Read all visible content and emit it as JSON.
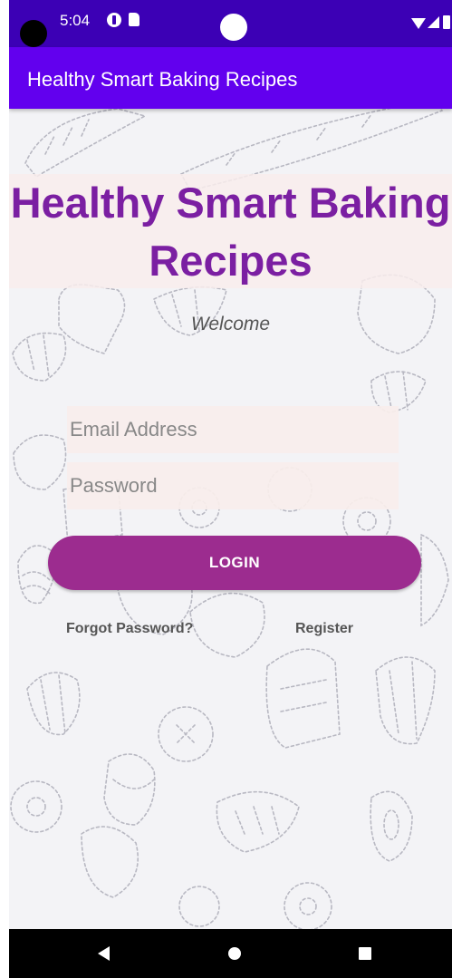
{
  "status_bar": {
    "time": "5:04"
  },
  "app_bar": {
    "title": "Healthy Smart Baking Recipes"
  },
  "main": {
    "heading": "Healthy Smart Baking Recipes",
    "welcome": "Welcome",
    "email_placeholder": "Email Address",
    "password_placeholder": "Password",
    "login_label": "LOGIN",
    "forgot_password": "Forgot Password?",
    "register": "Register"
  },
  "colors": {
    "status_bar": "#3c00b5",
    "app_bar": "#6200ee",
    "heading": "#7b1fa2",
    "login_button": "#9c2c8f"
  },
  "icons": [
    "camera-icon",
    "notification-icon",
    "sd-card-icon",
    "wifi-icon",
    "signal-icon",
    "battery-icon",
    "back-icon",
    "home-icon",
    "recents-icon"
  ]
}
